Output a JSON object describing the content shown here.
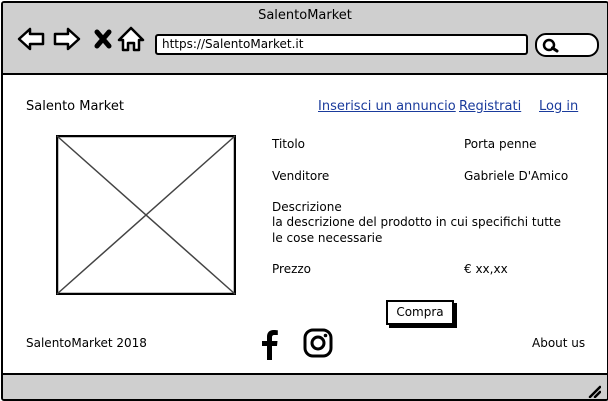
{
  "browser": {
    "window_title": "SalentoMarket",
    "url": "https://SalentoMarket.it",
    "icons": [
      "back-arrow-icon",
      "forward-arrow-icon",
      "close-x-icon",
      "home-icon",
      "search-icon"
    ]
  },
  "header": {
    "brand": "Salento Market",
    "nav": [
      {
        "label": "Inserisci un annuncio"
      },
      {
        "label": "Registrati"
      },
      {
        "label": "Log in"
      }
    ]
  },
  "product": {
    "image_icon": "image-placeholder-icon",
    "title_label": "Titolo",
    "title_value": "Porta penne",
    "seller_label": "Venditore",
    "seller_value": "Gabriele D'Amico",
    "description_label": "Descrizione",
    "description_line1": "la descrizione del prodotto in cui specifichi tutte",
    "description_line2": "le cose necessarie",
    "price_label": "Prezzo",
    "price_value": "€ xx,xx",
    "buy_label": "Compra"
  },
  "footer": {
    "copyright": "SalentoMarket 2018",
    "social_icons": [
      "facebook-icon",
      "instagram-icon"
    ],
    "about": "About us"
  },
  "colors": {
    "chrome": "#cfcfcf",
    "link": "#1a3b9c"
  }
}
